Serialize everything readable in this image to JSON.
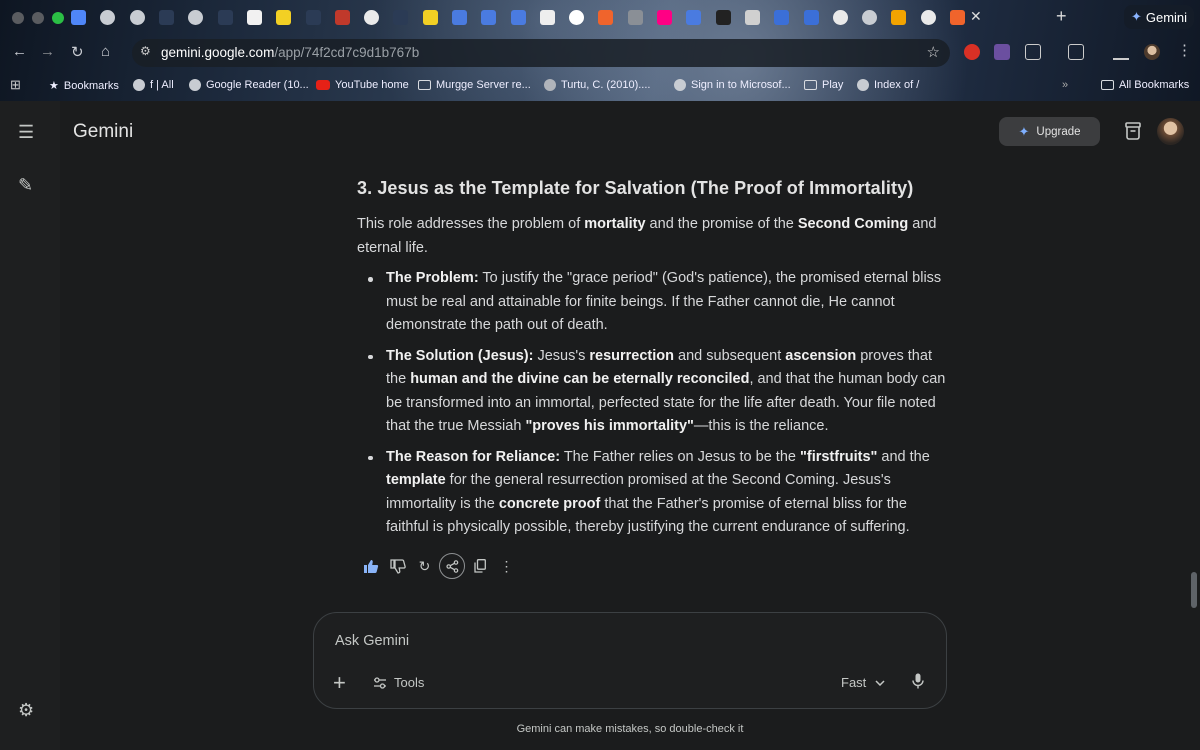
{
  "browser": {
    "tab_icons": [
      "docs-icon",
      "globe-icon",
      "globe-icon",
      "reader-icon",
      "globe-icon",
      "reader-icon",
      "grid-icon",
      "yellow-app-icon",
      "reader-icon",
      "red-arc-icon",
      "google-icon",
      "reader-icon",
      "yellow-app-icon",
      "gemini-icon",
      "gemini-icon",
      "gemini-icon",
      "rda-icon",
      "g-icon",
      "fox-icon",
      "audio-icon",
      "flickr-icon",
      "gemini-icon",
      "x-icon",
      "disco-icon",
      "waves-icon",
      "waves-icon",
      "google-icon",
      "globe-icon",
      "c-icon",
      "google-icon",
      "fox-icon"
    ],
    "active_tab_label": "Gemini",
    "url_host": "gemini.google.com",
    "url_path": "/app/74f2cd7c9d1b767b"
  },
  "bookmarks": [
    {
      "label": "Bookmarks",
      "icon": "star-icon"
    },
    {
      "label": "f | All",
      "icon": "globe-icon"
    },
    {
      "label": "Google Reader (10...",
      "icon": "globe-icon"
    },
    {
      "label": "YouTube home",
      "icon": "youtube-icon"
    },
    {
      "label": "Murgge Server re...",
      "icon": "folder-icon"
    },
    {
      "label": "Turtu, C. (2010)....",
      "icon": "pdf-icon"
    },
    {
      "label": "Sign in to Microsof...",
      "icon": "globe-icon"
    },
    {
      "label": "Play",
      "icon": "folder-icon"
    },
    {
      "label": "Index of /",
      "icon": "globe-icon"
    },
    {
      "label": "All Bookmarks",
      "icon": "folder-icon"
    }
  ],
  "app": {
    "title": "Gemini",
    "upgrade_label": "Upgrade"
  },
  "response": {
    "heading": "3. Jesus as the Template for Salvation (The Proof of Immortality)",
    "intro": [
      {
        "t": "This role addresses the problem of "
      },
      {
        "t": "mortality",
        "b": true
      },
      {
        "t": " and the promise of the "
      },
      {
        "t": "Second Coming",
        "b": true
      },
      {
        "t": " and eternal life."
      }
    ],
    "bullets": [
      [
        {
          "t": "The Problem:",
          "b": true
        },
        {
          "t": " To justify the \"grace period\" (God's patience), the promised eternal bliss must be real and attainable for finite beings. If the Father cannot die, He cannot demonstrate the path out of death."
        }
      ],
      [
        {
          "t": "The Solution (Jesus):",
          "b": true
        },
        {
          "t": " Jesus's "
        },
        {
          "t": "resurrection",
          "b": true
        },
        {
          "t": " and subsequent "
        },
        {
          "t": "ascension",
          "b": true
        },
        {
          "t": " proves that the "
        },
        {
          "t": "human and the divine can be eternally reconciled",
          "b": true
        },
        {
          "t": ", and that the human body can be transformed into an immortal, perfected state for the life after death. Your file noted that the true Messiah "
        },
        {
          "t": "\"proves his immortality\"",
          "b": true
        },
        {
          "t": "—this is the reliance."
        }
      ],
      [
        {
          "t": "The Reason for Reliance:",
          "b": true
        },
        {
          "t": " The Father relies on Jesus to be the "
        },
        {
          "t": "\"firstfruits\"",
          "b": true
        },
        {
          "t": " and the "
        },
        {
          "t": "template",
          "b": true
        },
        {
          "t": " for the general resurrection promised at the Second Coming. Jesus's immortality is the "
        },
        {
          "t": "concrete proof",
          "b": true
        },
        {
          "t": " that the Father's promise of eternal bliss for the faithful is physically possible, thereby justifying the current endurance of suffering."
        }
      ]
    ]
  },
  "composer": {
    "placeholder": "Ask Gemini",
    "tools_label": "Tools",
    "mode_label": "Fast"
  },
  "disclaimer": "Gemini can make mistakes, so double-check it",
  "colors": {
    "accent": "#7fb0ff",
    "surface": "#1e1f20",
    "background": "#1b1c1d"
  }
}
